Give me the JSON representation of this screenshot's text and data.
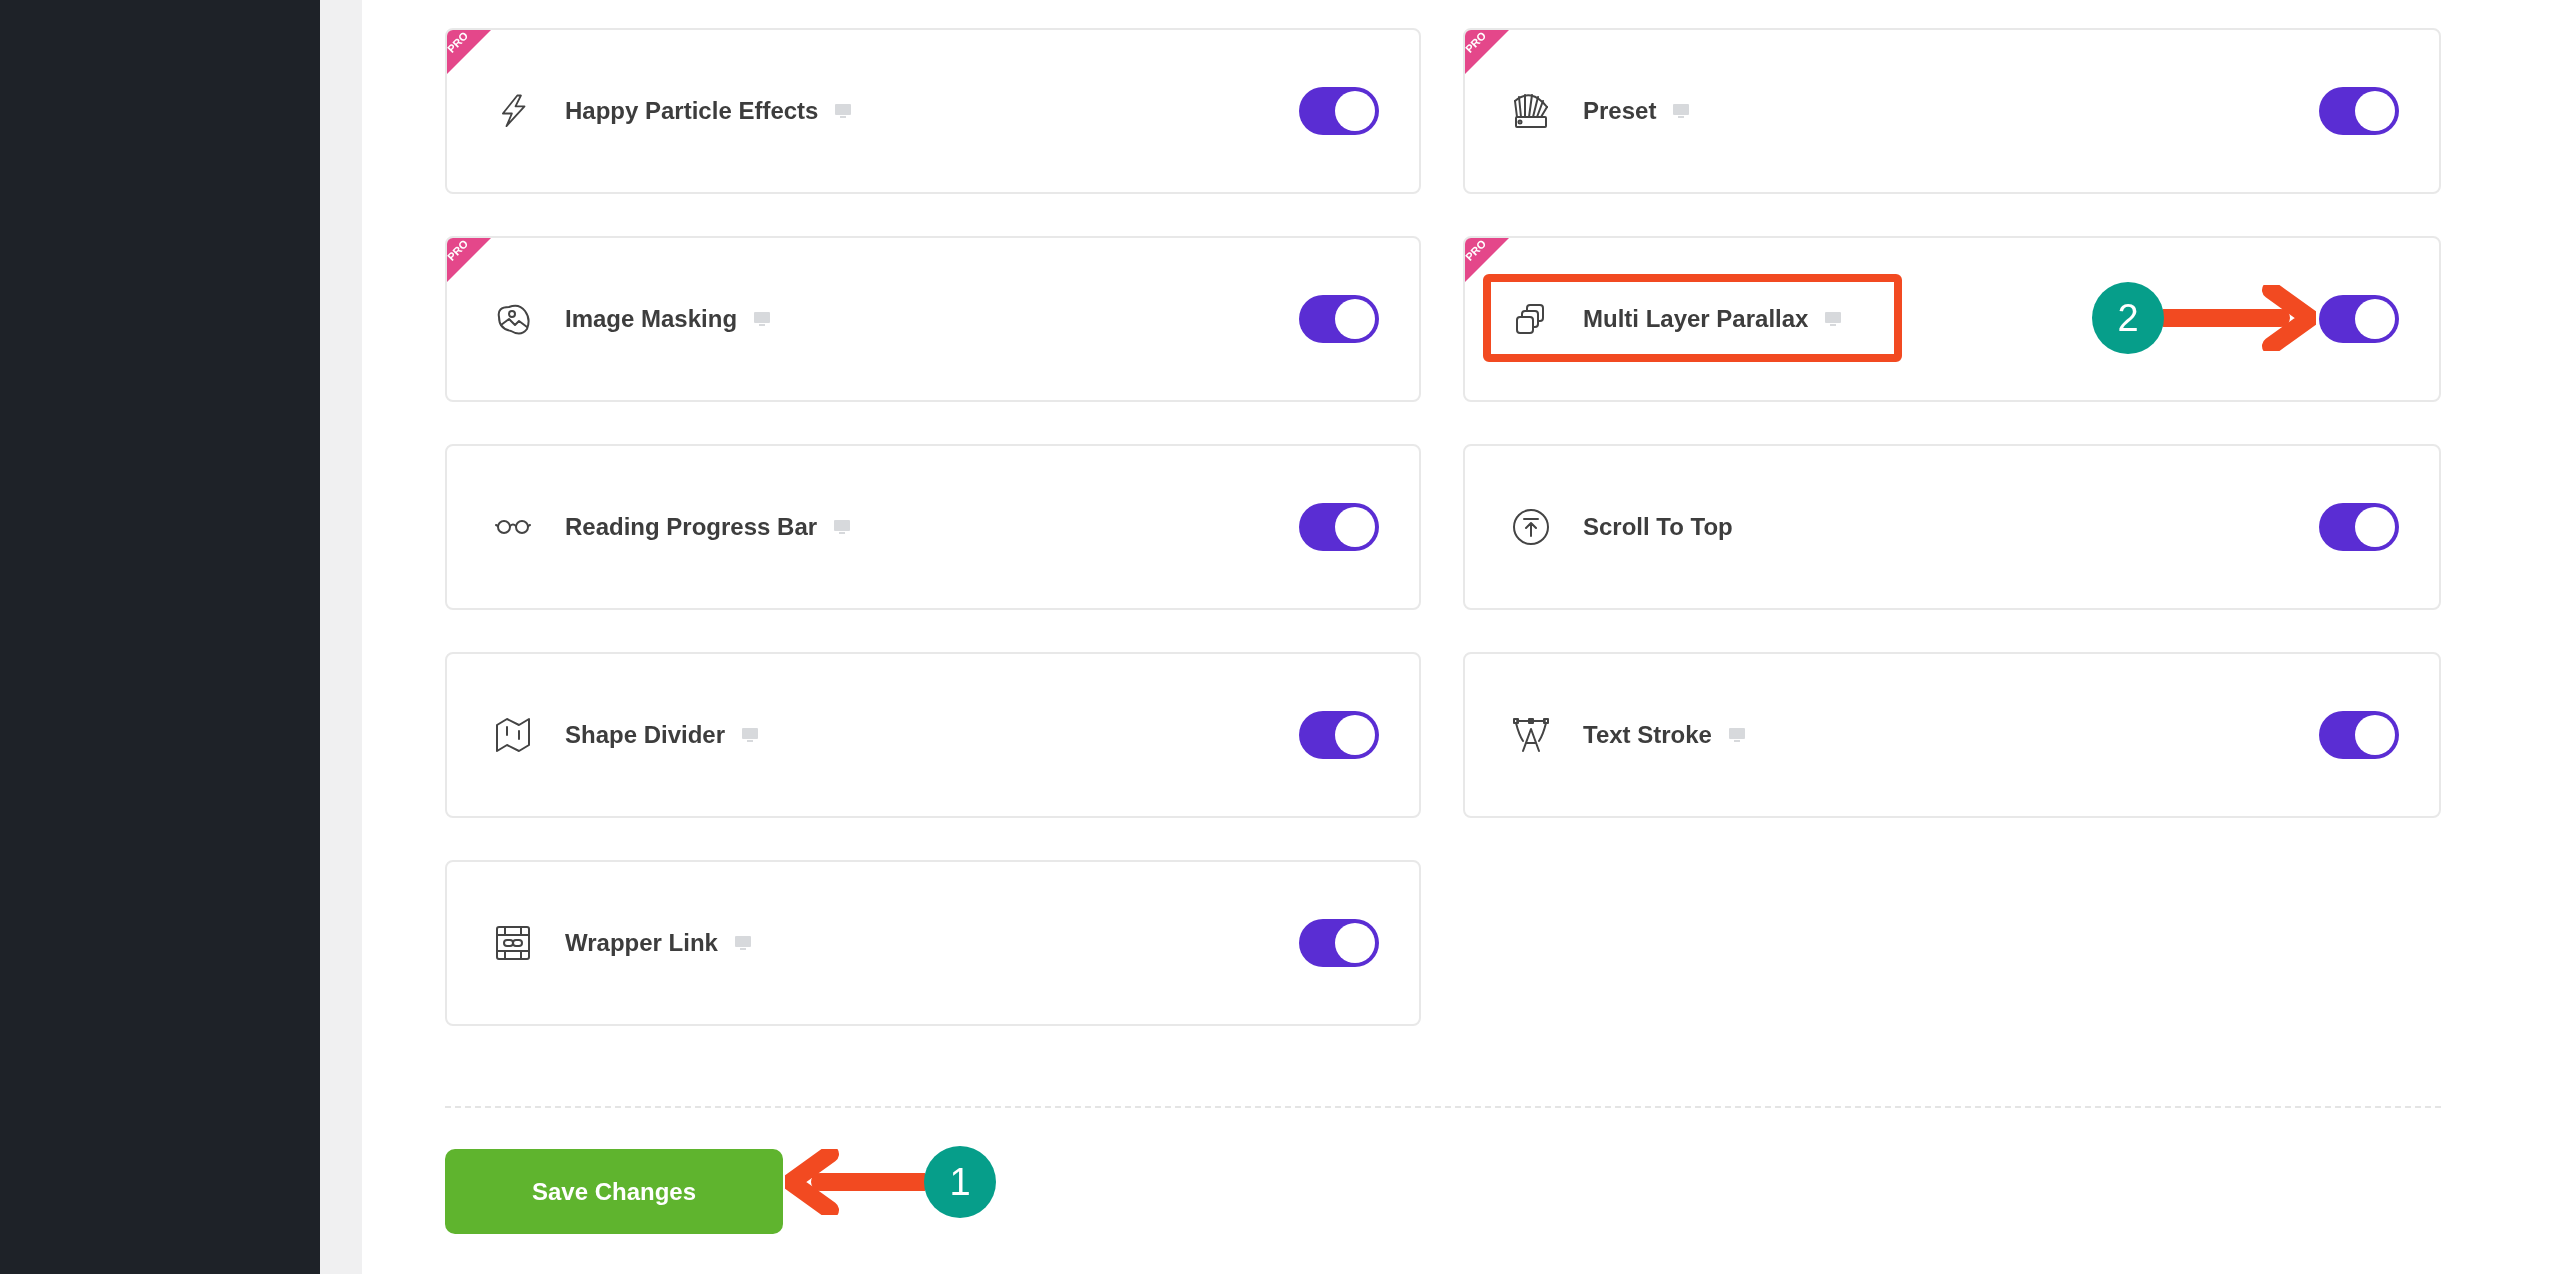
{
  "modules": [
    {
      "label": "Happy Particle Effects",
      "badge": "PRO",
      "device_icon": true,
      "on": true
    },
    {
      "label": "Preset",
      "badge": "PRO",
      "device_icon": true,
      "on": true
    },
    {
      "label": "Image Masking",
      "badge": "PRO",
      "device_icon": true,
      "on": true
    },
    {
      "label": "Multi Layer Parallax",
      "badge": "PRO",
      "device_icon": true,
      "on": true
    },
    {
      "label": "Reading Progress Bar",
      "device_icon": true,
      "on": true
    },
    {
      "label": "Scroll To Top",
      "device_icon": false,
      "on": true
    },
    {
      "label": "Shape Divider",
      "device_icon": true,
      "on": true
    },
    {
      "label": "Text Stroke",
      "device_icon": true,
      "on": true
    },
    {
      "label": "Wrapper Link",
      "device_icon": true,
      "on": true
    }
  ],
  "save_button": "Save Changes",
  "annotations": [
    {
      "number": "1",
      "kind": "left_arrow"
    },
    {
      "number": "2",
      "kind": "right_arrow_with_frame"
    }
  ]
}
